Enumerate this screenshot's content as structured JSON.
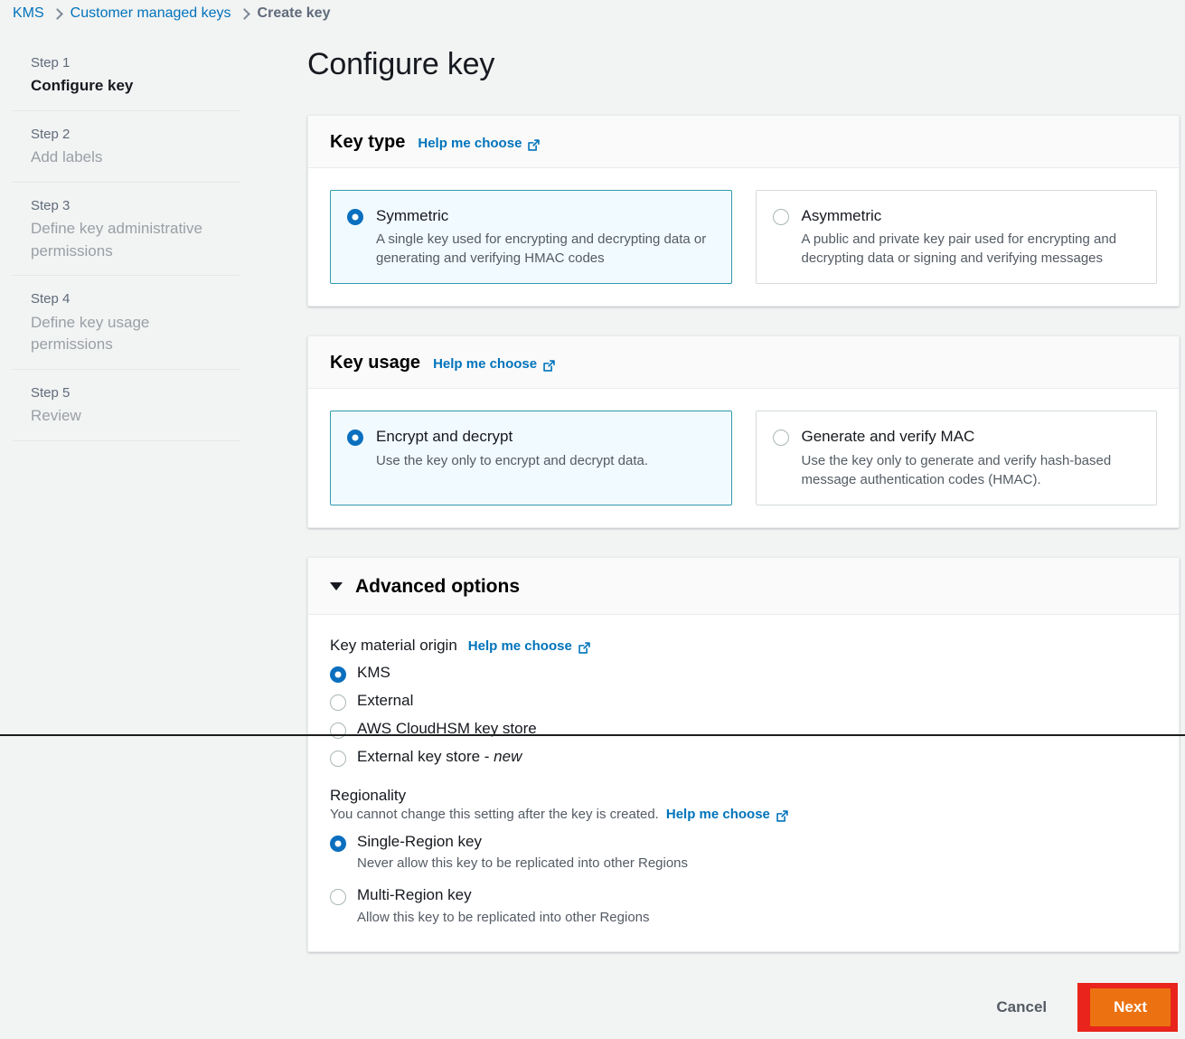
{
  "breadcrumb": {
    "items": [
      {
        "label": "KMS",
        "type": "link"
      },
      {
        "label": "Customer managed keys",
        "type": "link"
      },
      {
        "label": "Create key",
        "type": "current"
      }
    ]
  },
  "sidebar": {
    "steps": [
      {
        "num": "Step 1",
        "name": "Configure key",
        "active": true
      },
      {
        "num": "Step 2",
        "name": "Add labels",
        "active": false
      },
      {
        "num": "Step 3",
        "name": "Define key administrative permissions",
        "active": false
      },
      {
        "num": "Step 4",
        "name": "Define key usage permissions",
        "active": false
      },
      {
        "num": "Step 5",
        "name": "Review",
        "active": false
      }
    ]
  },
  "page": {
    "title": "Configure key"
  },
  "key_type": {
    "title": "Key type",
    "help_label": "Help me choose",
    "help_icon": "external-link-icon",
    "options": [
      {
        "label": "Symmetric",
        "desc": "A single key used for encrypting and decrypting data or generating and verifying HMAC codes",
        "selected": true
      },
      {
        "label": "Asymmetric",
        "desc": "A public and private key pair used for encrypting and decrypting data or signing and verifying messages",
        "selected": false
      }
    ]
  },
  "key_usage": {
    "title": "Key usage",
    "help_label": "Help me choose",
    "help_icon": "external-link-icon",
    "options": [
      {
        "label": "Encrypt and decrypt",
        "desc": "Use the key only to encrypt and decrypt data.",
        "selected": true
      },
      {
        "label": "Generate and verify MAC",
        "desc": "Use the key only to generate and verify hash-based message authentication codes (HMAC).",
        "selected": false
      }
    ]
  },
  "advanced": {
    "title": "Advanced options",
    "caret_icon": "caret-down-icon",
    "expanded": true,
    "key_material_origin": {
      "label": "Key material origin",
      "help_label": "Help me choose",
      "help_icon": "external-link-icon",
      "options": [
        {
          "label": "KMS",
          "selected": true
        },
        {
          "label": "External",
          "selected": false
        },
        {
          "label": "AWS CloudHSM key store",
          "selected": false
        },
        {
          "label": "External key store - ",
          "badge": "new",
          "selected": false
        }
      ]
    },
    "regionality": {
      "label": "Regionality",
      "note": "You cannot change this setting after the key is created.",
      "help_label": "Help me choose",
      "help_icon": "external-link-icon",
      "options": [
        {
          "label": "Single-Region key",
          "desc": "Never allow this key to be replicated into other Regions",
          "selected": true
        },
        {
          "label": "Multi-Region key",
          "desc": "Allow this key to be replicated into other Regions",
          "selected": false
        }
      ]
    }
  },
  "footer": {
    "cancel_label": "Cancel",
    "next_label": "Next"
  },
  "colors": {
    "link": "#0073bb",
    "selected_tile_border": "#2f9aab",
    "selected_tile_bg": "#f1faff",
    "radio_on": "#0a6fbf",
    "next_button": "#ec7211",
    "next_focus_ring": "#e8241c",
    "page_bg": "#f2f3f3"
  }
}
